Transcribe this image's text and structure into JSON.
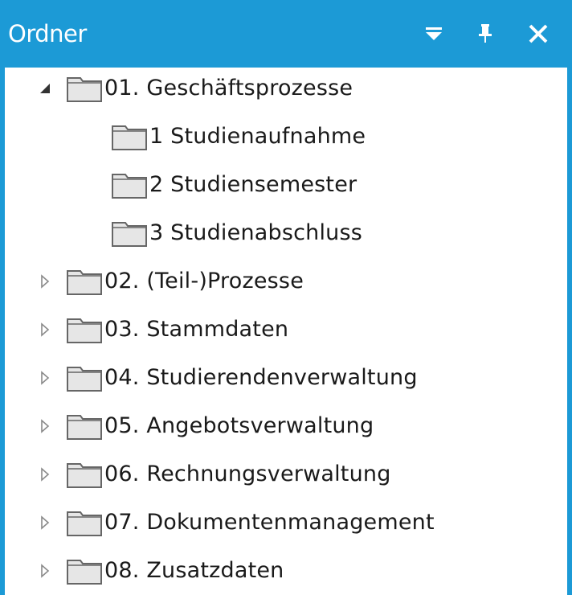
{
  "panel": {
    "title": "Ordner",
    "accent_color": "#1c9ad6",
    "buttons": {
      "dropdown": "dropdown-arrow-icon",
      "pin": "pin-icon",
      "close": "close-icon"
    }
  },
  "tree": {
    "items": [
      {
        "label": "01. Geschäftsprozesse",
        "expanded": true,
        "level": 0
      },
      {
        "label": "1 Studienaufnahme",
        "expanded": false,
        "level": 1
      },
      {
        "label": "2 Studiensemester",
        "expanded": false,
        "level": 1
      },
      {
        "label": "3 Studienabschluss",
        "expanded": false,
        "level": 1
      },
      {
        "label": "02. (Teil-)Prozesse",
        "expanded": false,
        "level": 0
      },
      {
        "label": "03. Stammdaten",
        "expanded": false,
        "level": 0
      },
      {
        "label": "04. Studierendenverwaltung",
        "expanded": false,
        "level": 0
      },
      {
        "label": "05. Angebotsverwaltung",
        "expanded": false,
        "level": 0
      },
      {
        "label": "06. Rechnungsverwaltung",
        "expanded": false,
        "level": 0
      },
      {
        "label": "07. Dokumentenmanagement",
        "expanded": false,
        "level": 0
      },
      {
        "label": "08. Zusatzdaten",
        "expanded": false,
        "level": 0
      }
    ]
  }
}
